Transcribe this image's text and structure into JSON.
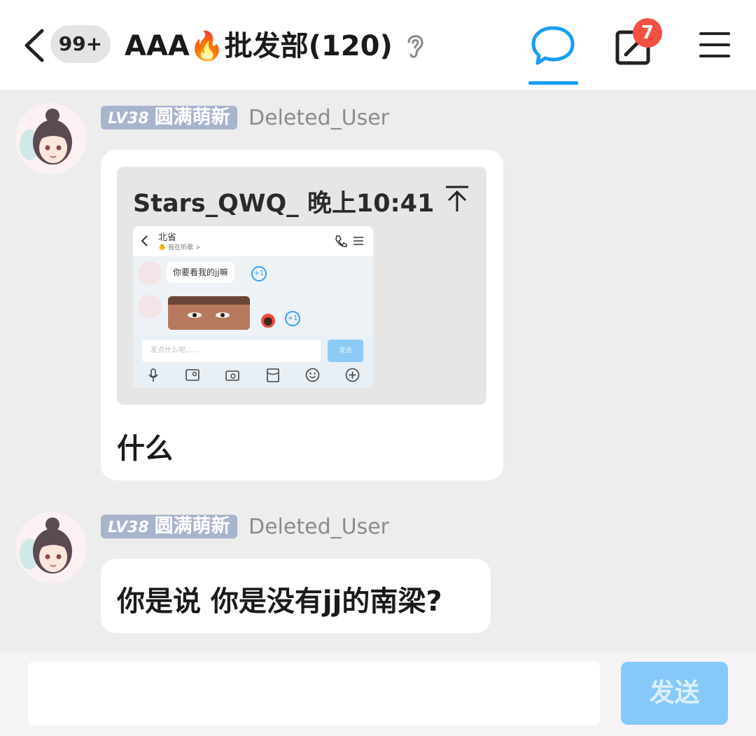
{
  "header": {
    "back_icon": "chevron-left-icon",
    "unread_badge": "99+",
    "group_title": "AAA🔥批发部(120)",
    "ear_icon": "ear-icon",
    "chat_tab_icon": "chat-bubble-icon",
    "compose_icon": "edit-square-icon",
    "compose_notification_count": "7",
    "menu_icon": "hamburger-menu-icon",
    "accent_color": "#1a9ef5"
  },
  "messages": [
    {
      "level": "LV38",
      "title_badge": "圆满萌新",
      "username": "Deleted_User",
      "quote": {
        "author_time": "Stars_QWQ_ 晚上10:41",
        "jump_icon": "jump-to-top-icon",
        "screenshot": {
          "contact_name": "北省",
          "contact_status": "🐥 我在听歌 >",
          "bubble_text": "你要看我的jj嘛",
          "plus_one": "+1",
          "input_placeholder": "发点什么呢......",
          "send_label": "发送"
        }
      },
      "text": "什么"
    },
    {
      "level": "LV38",
      "title_badge": "圆满萌新",
      "username": "Deleted_User",
      "text": "你是说 你是没有jj的南梁?"
    }
  ],
  "composer": {
    "input_value": "",
    "send_label": "发送"
  }
}
